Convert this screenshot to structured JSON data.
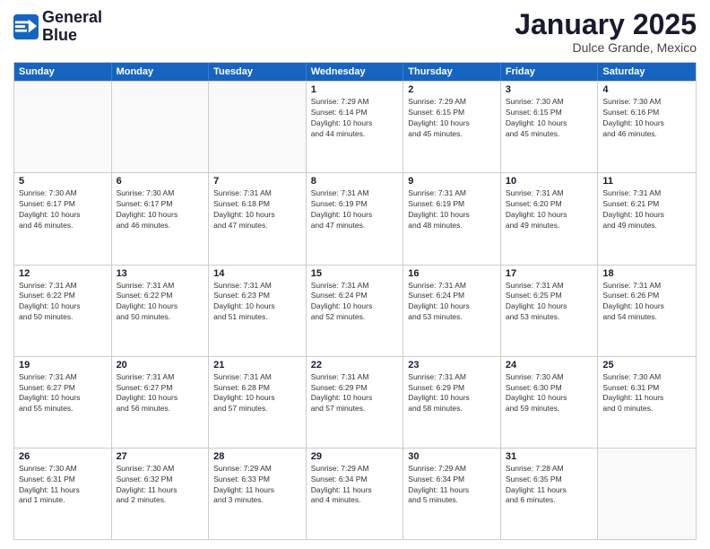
{
  "logo": {
    "line1": "General",
    "line2": "Blue"
  },
  "title": "January 2025",
  "subtitle": "Dulce Grande, Mexico",
  "days": [
    "Sunday",
    "Monday",
    "Tuesday",
    "Wednesday",
    "Thursday",
    "Friday",
    "Saturday"
  ],
  "rows": [
    [
      {
        "day": "",
        "info": ""
      },
      {
        "day": "",
        "info": ""
      },
      {
        "day": "",
        "info": ""
      },
      {
        "day": "1",
        "info": "Sunrise: 7:29 AM\nSunset: 6:14 PM\nDaylight: 10 hours\nand 44 minutes."
      },
      {
        "day": "2",
        "info": "Sunrise: 7:29 AM\nSunset: 6:15 PM\nDaylight: 10 hours\nand 45 minutes."
      },
      {
        "day": "3",
        "info": "Sunrise: 7:30 AM\nSunset: 6:15 PM\nDaylight: 10 hours\nand 45 minutes."
      },
      {
        "day": "4",
        "info": "Sunrise: 7:30 AM\nSunset: 6:16 PM\nDaylight: 10 hours\nand 46 minutes."
      }
    ],
    [
      {
        "day": "5",
        "info": "Sunrise: 7:30 AM\nSunset: 6:17 PM\nDaylight: 10 hours\nand 46 minutes."
      },
      {
        "day": "6",
        "info": "Sunrise: 7:30 AM\nSunset: 6:17 PM\nDaylight: 10 hours\nand 46 minutes."
      },
      {
        "day": "7",
        "info": "Sunrise: 7:31 AM\nSunset: 6:18 PM\nDaylight: 10 hours\nand 47 minutes."
      },
      {
        "day": "8",
        "info": "Sunrise: 7:31 AM\nSunset: 6:19 PM\nDaylight: 10 hours\nand 47 minutes."
      },
      {
        "day": "9",
        "info": "Sunrise: 7:31 AM\nSunset: 6:19 PM\nDaylight: 10 hours\nand 48 minutes."
      },
      {
        "day": "10",
        "info": "Sunrise: 7:31 AM\nSunset: 6:20 PM\nDaylight: 10 hours\nand 49 minutes."
      },
      {
        "day": "11",
        "info": "Sunrise: 7:31 AM\nSunset: 6:21 PM\nDaylight: 10 hours\nand 49 minutes."
      }
    ],
    [
      {
        "day": "12",
        "info": "Sunrise: 7:31 AM\nSunset: 6:22 PM\nDaylight: 10 hours\nand 50 minutes."
      },
      {
        "day": "13",
        "info": "Sunrise: 7:31 AM\nSunset: 6:22 PM\nDaylight: 10 hours\nand 50 minutes."
      },
      {
        "day": "14",
        "info": "Sunrise: 7:31 AM\nSunset: 6:23 PM\nDaylight: 10 hours\nand 51 minutes."
      },
      {
        "day": "15",
        "info": "Sunrise: 7:31 AM\nSunset: 6:24 PM\nDaylight: 10 hours\nand 52 minutes."
      },
      {
        "day": "16",
        "info": "Sunrise: 7:31 AM\nSunset: 6:24 PM\nDaylight: 10 hours\nand 53 minutes."
      },
      {
        "day": "17",
        "info": "Sunrise: 7:31 AM\nSunset: 6:25 PM\nDaylight: 10 hours\nand 53 minutes."
      },
      {
        "day": "18",
        "info": "Sunrise: 7:31 AM\nSunset: 6:26 PM\nDaylight: 10 hours\nand 54 minutes."
      }
    ],
    [
      {
        "day": "19",
        "info": "Sunrise: 7:31 AM\nSunset: 6:27 PM\nDaylight: 10 hours\nand 55 minutes."
      },
      {
        "day": "20",
        "info": "Sunrise: 7:31 AM\nSunset: 6:27 PM\nDaylight: 10 hours\nand 56 minutes."
      },
      {
        "day": "21",
        "info": "Sunrise: 7:31 AM\nSunset: 6:28 PM\nDaylight: 10 hours\nand 57 minutes."
      },
      {
        "day": "22",
        "info": "Sunrise: 7:31 AM\nSunset: 6:29 PM\nDaylight: 10 hours\nand 57 minutes."
      },
      {
        "day": "23",
        "info": "Sunrise: 7:31 AM\nSunset: 6:29 PM\nDaylight: 10 hours\nand 58 minutes."
      },
      {
        "day": "24",
        "info": "Sunrise: 7:30 AM\nSunset: 6:30 PM\nDaylight: 10 hours\nand 59 minutes."
      },
      {
        "day": "25",
        "info": "Sunrise: 7:30 AM\nSunset: 6:31 PM\nDaylight: 11 hours\nand 0 minutes."
      }
    ],
    [
      {
        "day": "26",
        "info": "Sunrise: 7:30 AM\nSunset: 6:31 PM\nDaylight: 11 hours\nand 1 minute."
      },
      {
        "day": "27",
        "info": "Sunrise: 7:30 AM\nSunset: 6:32 PM\nDaylight: 11 hours\nand 2 minutes."
      },
      {
        "day": "28",
        "info": "Sunrise: 7:29 AM\nSunset: 6:33 PM\nDaylight: 11 hours\nand 3 minutes."
      },
      {
        "day": "29",
        "info": "Sunrise: 7:29 AM\nSunset: 6:34 PM\nDaylight: 11 hours\nand 4 minutes."
      },
      {
        "day": "30",
        "info": "Sunrise: 7:29 AM\nSunset: 6:34 PM\nDaylight: 11 hours\nand 5 minutes."
      },
      {
        "day": "31",
        "info": "Sunrise: 7:28 AM\nSunset: 6:35 PM\nDaylight: 11 hours\nand 6 minutes."
      },
      {
        "day": "",
        "info": ""
      }
    ]
  ]
}
